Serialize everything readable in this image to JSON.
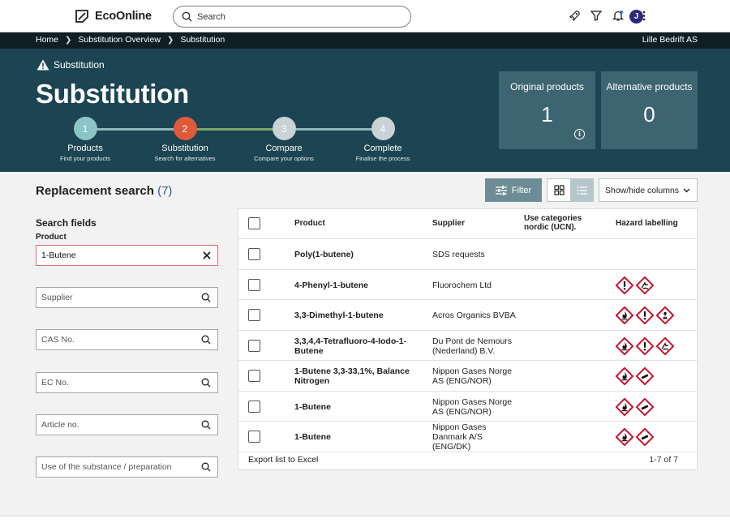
{
  "app": {
    "logo_text": "EcoOnline",
    "avatar_initial": "J"
  },
  "search": {
    "placeholder": "Search"
  },
  "topbar_icons": [
    "rocket-icon",
    "filter-icon",
    "bell-icon",
    "apps-grid-icon"
  ],
  "breadcrumb": {
    "items": [
      "Home",
      "Substitution Overview",
      "Substitution"
    ],
    "company": "Lille Bedrift AS"
  },
  "hero": {
    "section_label": "Substitution",
    "title": "Substitution",
    "steps": [
      {
        "number": "1",
        "label": "Products",
        "desc": "Find your products",
        "state": "done"
      },
      {
        "number": "2",
        "label": "Substitution",
        "desc": "Search for alternatives",
        "state": "current"
      },
      {
        "number": "3",
        "label": "Compare",
        "desc": "Compare your options",
        "state": "pending"
      },
      {
        "number": "4",
        "label": "Complete",
        "desc": "Finalise the process",
        "state": "pending"
      }
    ],
    "stats": [
      {
        "label": "Original products",
        "value": "1",
        "info": "i"
      },
      {
        "label": "Alternative products",
        "value": "0"
      }
    ]
  },
  "results": {
    "title": "Replacement search",
    "count": "(7)",
    "filter_label": "Filter",
    "columns_label": "Show/hide columns"
  },
  "search_fields": {
    "title": "Search fields",
    "product_label": "Product",
    "product_value": "1-Butene",
    "supplier_placeholder": "Supplier",
    "cas_placeholder": "CAS No.",
    "ec_placeholder": "EC No.",
    "article_placeholder": "Article no.",
    "use_placeholder": "Use of the substance / preparation"
  },
  "table": {
    "headers": {
      "product": "Product",
      "supplier": "Supplier",
      "use_categories": "Use categories nordic (UCN).",
      "hazard": "Hazard labelling"
    },
    "rows": [
      {
        "product": "Poly(1-butene)",
        "supplier": "SDS requests",
        "hazards": []
      },
      {
        "product": "4-Phenyl-1-butene",
        "supplier": "Fluorochem Ltd",
        "hazards": [
          "exclamation",
          "environment"
        ]
      },
      {
        "product": "3,3-Dimethyl-1-butene",
        "supplier": "Acros Organics BVBA",
        "hazards": [
          "flame",
          "exclamation",
          "health"
        ]
      },
      {
        "product": "3,3,4,4-Tetrafluoro-4-Iodo-1-Butene",
        "supplier": "Du Pont de Nemours (Nederland) B.V.",
        "hazards": [
          "flame",
          "exclamation",
          "environment"
        ]
      },
      {
        "product": "1-Butene 3,3-33,1%, Balance Nitrogen",
        "supplier": "Nippon Gases Norge AS (ENG/NOR)",
        "hazards": [
          "flame",
          "gas-cylinder"
        ]
      },
      {
        "product": "1-Butene",
        "supplier": "Nippon Gases Norge AS (ENG/NOR)",
        "hazards": [
          "flame",
          "gas-cylinder"
        ]
      },
      {
        "product": "1-Butene",
        "supplier": "Nippon Gases Danmark A/S (ENG/DK)",
        "hazards": [
          "flame",
          "gas-cylinder"
        ]
      }
    ],
    "export_label": "Export list to Excel",
    "pager": "1-7 of 7"
  },
  "colors": {
    "hero_bg": "#1c4452",
    "crumb_bg": "#0f1f24",
    "step_current": "#e05a3a",
    "step_done": "#8bc5c8",
    "hazard_red": "#c8102e"
  }
}
